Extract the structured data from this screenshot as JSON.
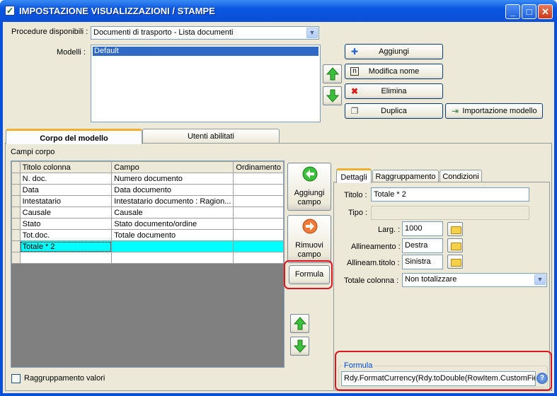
{
  "window": {
    "title": "IMPOSTAZIONE VISUALIZZAZIONI / STAMPE",
    "minimize": "_",
    "maximize": "□",
    "close": "✕"
  },
  "procedure": {
    "label": "Procedure disponibili :",
    "value": "Documenti di trasporto - Lista documenti"
  },
  "modelli": {
    "label": "Modelli :",
    "items": [
      "Default"
    ]
  },
  "buttons": {
    "aggiungi": "Aggiungi",
    "modifica_nome": "Modifica nome",
    "elimina": "Elimina",
    "duplica": "Duplica",
    "importazione_modello": "Importazione modello"
  },
  "tabs": {
    "corpo": "Corpo del modello",
    "utenti": "Utenti abilitati"
  },
  "campi": {
    "label": "Campi corpo",
    "headers": [
      "Titolo colonna",
      "Campo",
      "Ordinamento"
    ],
    "rows": [
      [
        "N. doc.",
        "Numero documento",
        ""
      ],
      [
        "Data",
        "Data documento",
        ""
      ],
      [
        "Intestatario",
        "Intestatario documento : Ragion...",
        ""
      ],
      [
        "Causale",
        "Causale",
        ""
      ],
      [
        "Stato",
        "Stato documento/ordine",
        ""
      ],
      [
        "Tot.doc.",
        "Totale documento",
        ""
      ],
      [
        "Totale * 2",
        "",
        ""
      ],
      [
        "",
        "",
        ""
      ]
    ]
  },
  "side": {
    "aggiungi_campo": [
      "Aggiungi",
      "campo"
    ],
    "rimuovi_campo": [
      "Rimuovi",
      "campo"
    ],
    "formula": "Formula"
  },
  "raggruppamento": {
    "label": "Raggruppamento valori"
  },
  "detail_tabs": {
    "dettagli": "Dettagli",
    "raggruppamento": "Raggruppamento",
    "condizioni": "Condizioni"
  },
  "detail": {
    "titolo_label": "Titolo :",
    "titolo_value": "Totale * 2",
    "tipo_label": "Tipo :",
    "tipo_value": "",
    "larg_label": "Larg. :",
    "larg_value": "1000",
    "allineamento_label": "Allineamento :",
    "allineamento_value": "Destra",
    "allineam_titolo_label": "Allineam.titolo :",
    "allineam_titolo_value": "Sinistra",
    "totale_label": "Totale colonna :",
    "totale_value": "Non totalizzare"
  },
  "formula": {
    "group_label": "Formula",
    "value": "Rdy.FormatCurrency(Rdy.toDouble(RowItem.CustomFie",
    "help": "?"
  }
}
